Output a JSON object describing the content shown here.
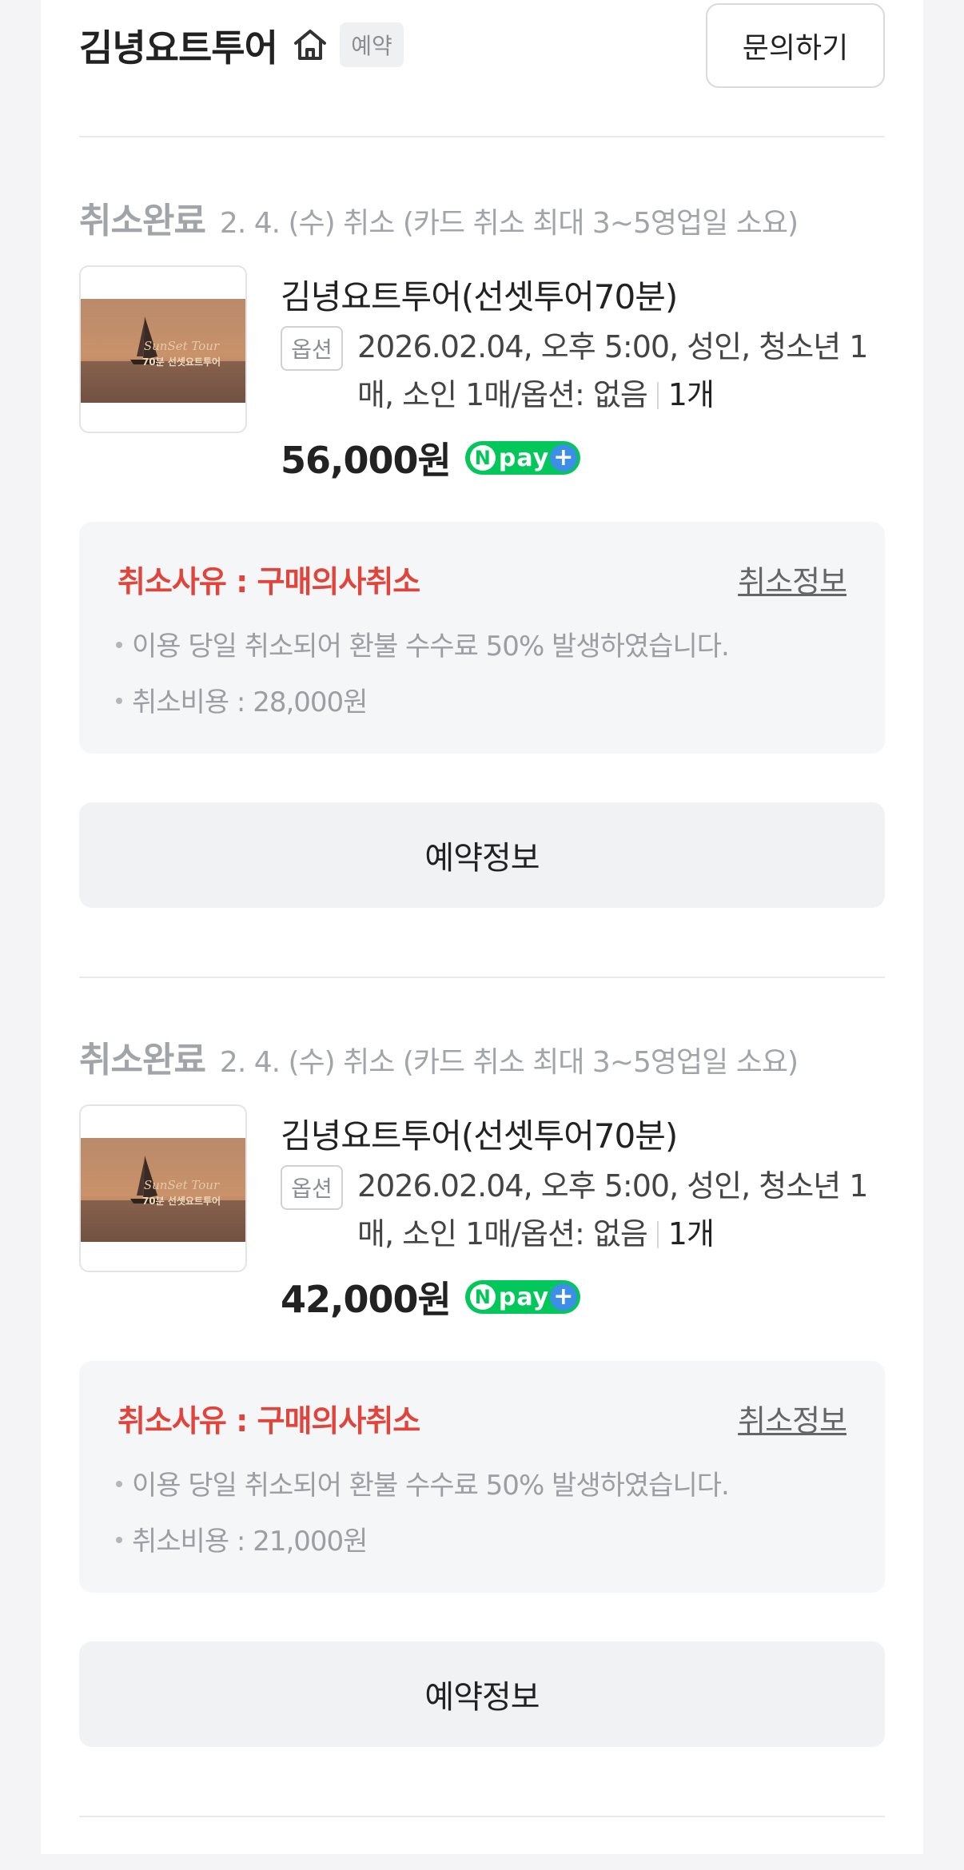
{
  "header": {
    "store_name": "김녕요트투어",
    "badge": "예약",
    "inquiry_label": "문의하기"
  },
  "orders": [
    {
      "status": "취소완료",
      "status_detail": "2. 4. (수) 취소 (카드 취소 최대 3~5영업일 소요)",
      "product_name": "김녕요트투어(선셋투어70분)",
      "option_tag": "옵션",
      "option_text": "2026.02.04, 오후 5:00, 성인, 청소년 1매, 소인 1매/옵션: 없음",
      "quantity": "1개",
      "price": "56,000원",
      "cancel_reason": "취소사유 : 구매의사취소",
      "cancel_info_label": "취소정보",
      "notes": [
        "이용 당일 취소되어 환불 수수료 50% 발생하였습니다.",
        "취소비용 : 28,000원"
      ],
      "reservation_label": "예약정보"
    },
    {
      "status": "취소완료",
      "status_detail": "2. 4. (수) 취소 (카드 취소 최대 3~5영업일 소요)",
      "product_name": "김녕요트투어(선셋투어70분)",
      "option_tag": "옵션",
      "option_text": "2026.02.04, 오후 5:00, 성인, 청소년 1매, 소인 1매/옵션: 없음",
      "quantity": "1개",
      "price": "42,000원",
      "cancel_reason": "취소사유 : 구매의사취소",
      "cancel_info_label": "취소정보",
      "notes": [
        "이용 당일 취소되어 환불 수수료 50% 발생하였습니다.",
        "취소비용 : 21,000원"
      ],
      "reservation_label": "예약정보"
    }
  ],
  "npay": {
    "n": "N",
    "word": "pay",
    "plus": "+"
  },
  "thumbnail": {
    "line1": "SunSet Tour",
    "line2": "70분 선셋요트투어"
  },
  "colors": {
    "cancel_red": "#e0443a",
    "npay_green": "#03c75a",
    "npay_blue": "#3d8ee6"
  },
  "icons": {
    "home": "home-icon"
  }
}
